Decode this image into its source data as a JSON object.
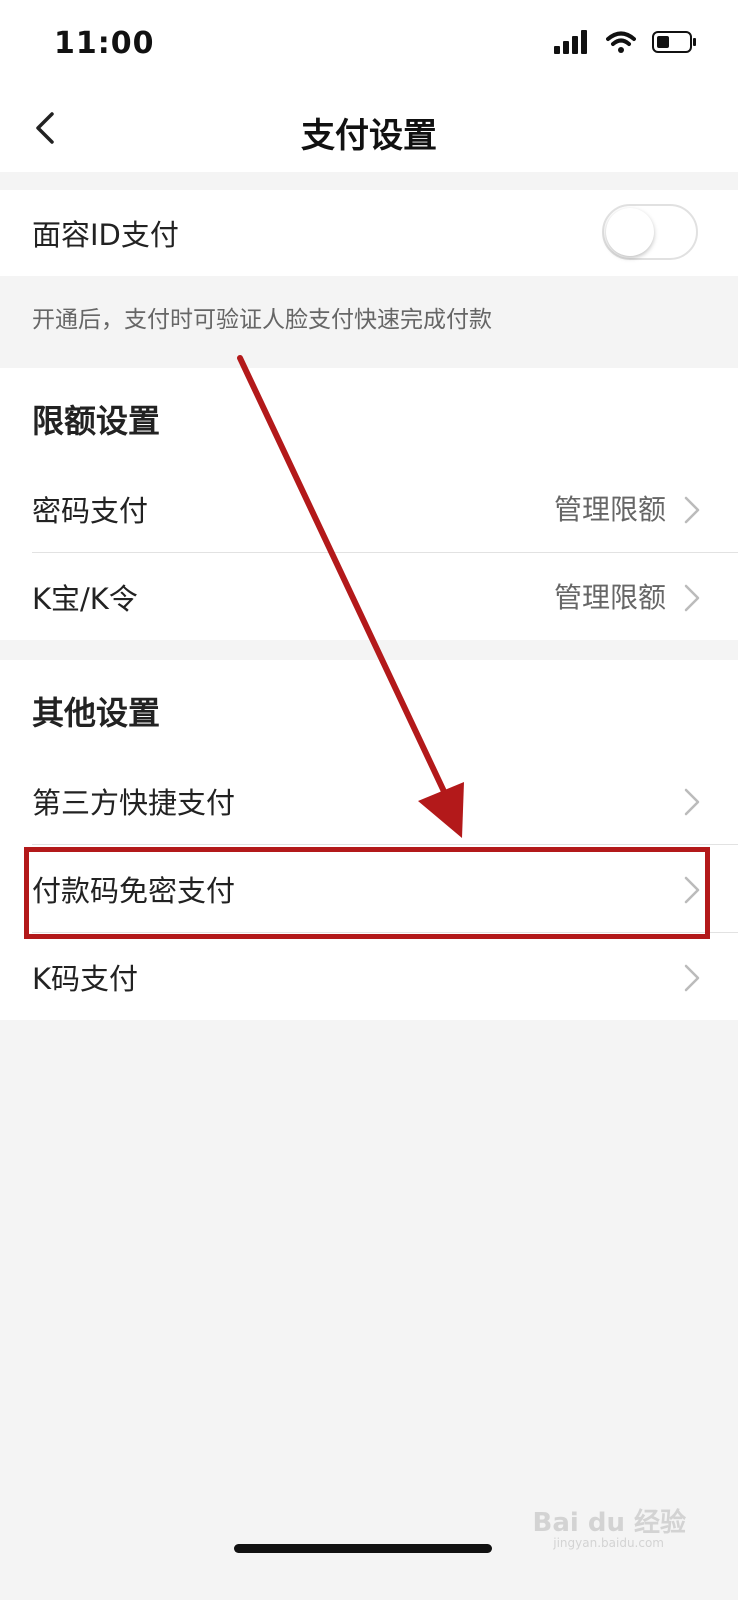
{
  "status_bar": {
    "time": "11:00",
    "signal_icon": "signal-bars-icon",
    "wifi_icon": "wifi-icon",
    "battery_icon": "battery-icon"
  },
  "nav": {
    "title": "支付设置",
    "back_icon": "chevron-left-icon"
  },
  "face_id": {
    "label": "面容ID支付",
    "enabled": false,
    "hint": "开通后，支付时可验证人脸支付快速完成付款"
  },
  "limits": {
    "heading": "限额设置",
    "items": [
      {
        "label": "密码支付",
        "value": "管理限额"
      },
      {
        "label": "K宝/K令",
        "value": "管理限额"
      }
    ]
  },
  "other": {
    "heading": "其他设置",
    "items": [
      {
        "label": "第三方快捷支付"
      },
      {
        "label": "付款码免密支付"
      },
      {
        "label": "K码支付"
      }
    ]
  },
  "annotation": {
    "color": "#b3191a"
  },
  "watermark": {
    "text": "Bai du 经验",
    "sub": "jingyan.baidu.com"
  }
}
